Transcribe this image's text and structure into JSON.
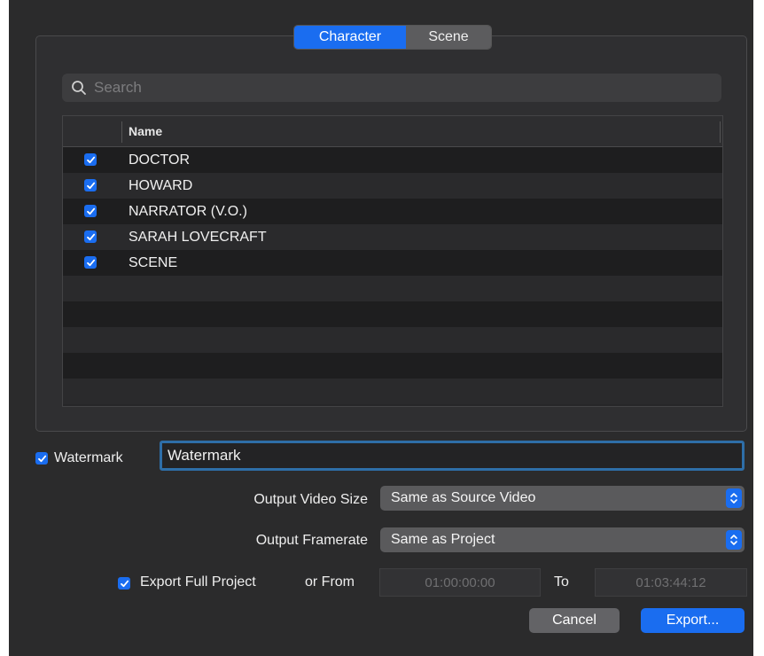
{
  "tabs": {
    "character": "Character",
    "scene": "Scene"
  },
  "search": {
    "placeholder": "Search",
    "value": ""
  },
  "table": {
    "header": "Name",
    "rows": [
      {
        "name": "DOCTOR",
        "checked": true
      },
      {
        "name": "HOWARD",
        "checked": true
      },
      {
        "name": "NARRATOR (V.O.)",
        "checked": true
      },
      {
        "name": "SARAH LOVECRAFT",
        "checked": true
      },
      {
        "name": "SCENE",
        "checked": true
      }
    ]
  },
  "watermark": {
    "label": "Watermark",
    "checked": true,
    "value": "Watermark"
  },
  "output_video_size": {
    "label": "Output Video Size",
    "value": "Same as Source Video"
  },
  "output_framerate": {
    "label": "Output Framerate",
    "value": "Same as Project"
  },
  "export_range": {
    "full_label": "Export Full Project",
    "checked": true,
    "from_label": "or From",
    "from_value": "01:00:00:00",
    "to_label": "To",
    "to_value": "01:03:44:12"
  },
  "buttons": {
    "cancel": "Cancel",
    "export": "Export..."
  },
  "colors": {
    "accent": "#1a6df0",
    "background": "#2b2b2c",
    "focus_ring": "#2e6ea8"
  },
  "icons": {
    "search": "search-icon",
    "checkbox": "checkmark-icon",
    "popup": "up-down-chevron-icon"
  }
}
